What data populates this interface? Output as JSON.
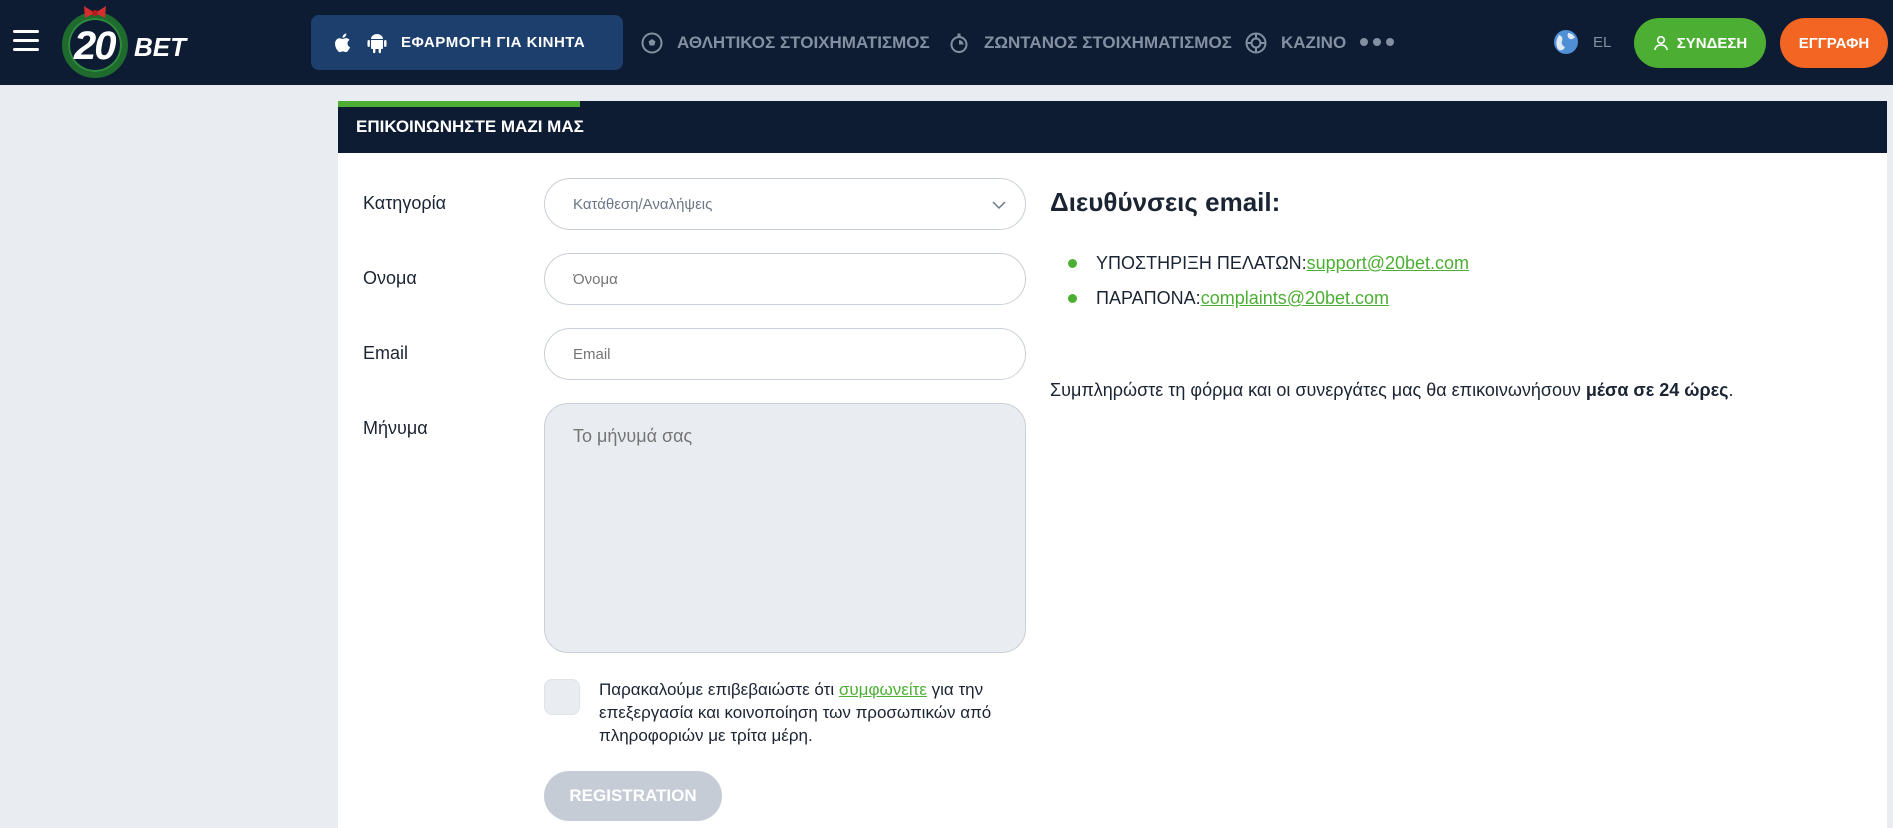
{
  "header": {
    "logo_text_number": "20",
    "logo_text_brand": "BET",
    "app_button_label": "ΕΦΑΡΜΟΓΗ ΓΙΑ ΚΙΝΗΤΑ",
    "nav": [
      {
        "label": "ΑΘΛΗΤΙΚΟΣ ΣΤΟΙΧΗΜΑΤΙΣΜΟΣ",
        "icon": "soccer-ball-icon"
      },
      {
        "label": "ΖΩΝΤΑΝΟΣ ΣΤΟΙΧΗΜΑΤΙΣΜΟΣ",
        "icon": "stopwatch-icon"
      },
      {
        "label": "ΚΑΖΙΝΟ",
        "icon": "roulette-icon"
      }
    ],
    "language": "EL",
    "login_label": "ΣΥΝΔΕΣΗ",
    "register_label": "ΕΓΓΡΑΦΗ"
  },
  "colors": {
    "header_bg": "#0e1c33",
    "accent_green": "#4caf34",
    "register_orange": "#f26522",
    "app_button_bg": "#1d3f6e"
  },
  "contact": {
    "title": "ΕΠΙΚΟΙΝΩΝΗΣΤΕ ΜΑΖΙ ΜΑΣ",
    "form": {
      "category_label": "Κατηγορία",
      "category_value": "Κατάθεση/Αναλήψεις",
      "name_label": "Ονομα",
      "name_placeholder": "Όνομα",
      "email_label": "Email",
      "email_placeholder": "Email",
      "message_label": "Μήνυμα",
      "message_placeholder": "Το μήνυμά σας",
      "consent_prefix": "Παρακαλούμε επιβεβαιώστε ότι ",
      "consent_link": "συμφωνείτε",
      "consent_suffix": " για την επεξεργασία και κοινοποίηση των προσωπικών από πληροφοριών με τρίτα μέρη.",
      "submit_label": "REGISTRATION"
    },
    "emails_title": "Διευθύνσεις email:",
    "emails": [
      {
        "label": "ΥΠΟΣΤΗΡΙΞΗ ΠΕΛΑΤΩΝ:",
        "address": "support@20bet.com"
      },
      {
        "label": "ΠΑΡΑΠΟΝΑ:",
        "address": "complaints@20bet.com"
      }
    ],
    "info_text": "Συμπληρώστε τη φόρμα και οι συνεργάτες μας θα επικοινωνήσουν ",
    "info_bold": "μέσα σε 24 ώρες",
    "info_end": "."
  }
}
